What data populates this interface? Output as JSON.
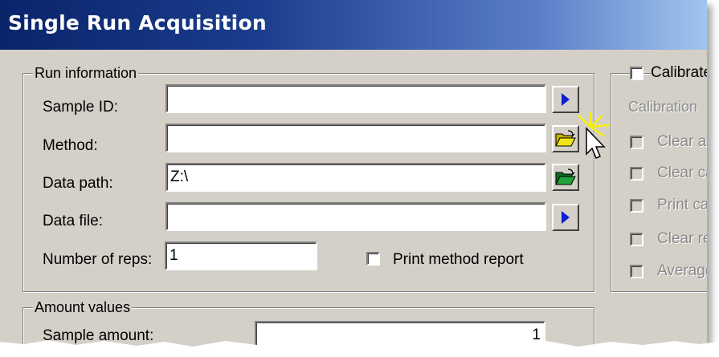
{
  "window": {
    "title": "Single Run Acquisition"
  },
  "run_information": {
    "legend": "Run information",
    "sample_id": {
      "label": "Sample ID:",
      "value": ""
    },
    "method": {
      "label": "Method:",
      "value": ""
    },
    "data_path": {
      "label": "Data path:",
      "value": "Z:\\"
    },
    "data_file": {
      "label": "Data file:",
      "value": ""
    },
    "number_of_reps": {
      "label": "Number of reps:",
      "value": "1"
    },
    "print_method_report": {
      "label": "Print method report",
      "checked": false
    }
  },
  "calibration": {
    "calibrate_label": "Calibrate",
    "calibration_label": "Calibration",
    "options": [
      "Clear all",
      "Clear ca",
      "Print ca",
      "Clear re",
      "Average"
    ]
  },
  "amount_values": {
    "legend": "Amount values",
    "sample_amount": {
      "label": "Sample amount:",
      "value": "1"
    }
  },
  "colors": {
    "title_start": "#0a246a",
    "title_end": "#a6caf0",
    "dialog_bg": "#d4d0c8",
    "folder_yellow": "#f2e21a",
    "folder_green": "#1fa33a",
    "arrow_blue": "#0a1fd6"
  }
}
